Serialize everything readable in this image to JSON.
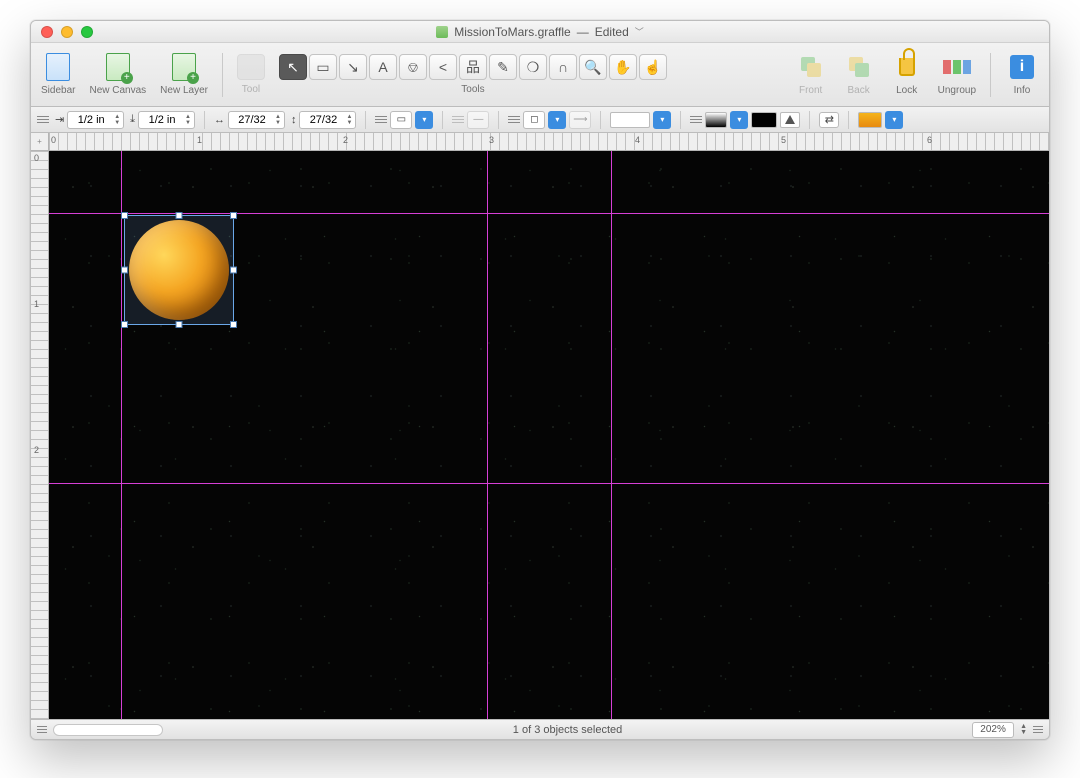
{
  "window": {
    "filename": "MissionToMars.graffle",
    "edit_state": "Edited"
  },
  "toolbar": {
    "sidebar": "Sidebar",
    "new_canvas": "New Canvas",
    "new_layer": "New Layer",
    "tool": "Tool",
    "tools": "Tools",
    "front": "Front",
    "back": "Back",
    "lock": "Lock",
    "ungroup": "Ungroup",
    "info": "Info"
  },
  "inspector": {
    "hspace": "1/2 in",
    "vspace": "1/2 in",
    "width": "27/32",
    "height": "27/32"
  },
  "ruler": {
    "h": [
      "0",
      "1",
      "2",
      "3",
      "4",
      "5",
      "6"
    ],
    "v": [
      "0",
      "1",
      "2"
    ]
  },
  "status": {
    "selection": "1 of 3 objects selected",
    "zoom": "202%"
  }
}
